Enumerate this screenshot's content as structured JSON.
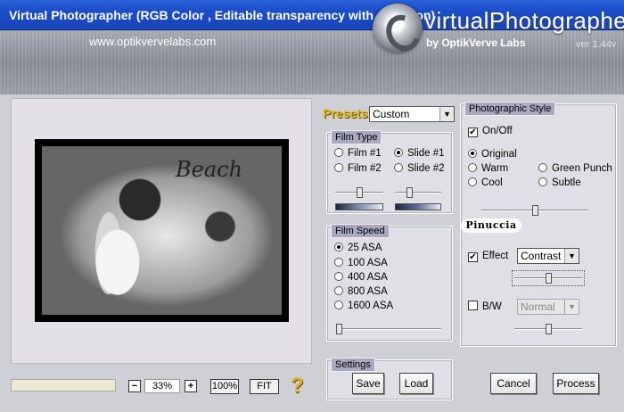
{
  "window": {
    "title": "Virtual Photographer (RGB Color , Editable transparency with selection)"
  },
  "header": {
    "url": "www.optikvervelabs.com",
    "brand": "virtualPhotographer",
    "brand_sub": "by OptikVerve Labs",
    "version": "ver 1.44v"
  },
  "preview": {
    "photo_text": "Beach"
  },
  "zoom": {
    "minus": "−",
    "value": "33%",
    "plus": "+",
    "btn_100": "100%",
    "btn_fit": "FIT",
    "help": "?"
  },
  "presets": {
    "label": "Presets",
    "value": "Custom"
  },
  "film_type": {
    "title": "Film Type",
    "options": [
      "Film #1",
      "Film #2",
      "Slide #1",
      "Slide #2"
    ],
    "selected": "Slide #1",
    "slider_left": 0.5,
    "slider_right": 0.3
  },
  "film_speed": {
    "title": "Film Speed",
    "options": [
      "25 ASA",
      "100 ASA",
      "400 ASA",
      "800 ASA",
      "1600 ASA"
    ],
    "selected": "25 ASA",
    "slider": 0.0
  },
  "settings": {
    "title": "Settings",
    "save": "Save",
    "load": "Load"
  },
  "photo_style": {
    "title": "Photographic Style",
    "onoff_label": "On/Off",
    "onoff_checked": true,
    "styles": [
      "Original",
      "Warm",
      "Cool",
      "Green Punch",
      "Subtle"
    ],
    "selected": "Original",
    "style_slider": 0.5,
    "watermark": "Pinuccia",
    "effect_label": "Effect",
    "effect_checked": true,
    "effect_value": "Contrast",
    "effect_slider": 0.5,
    "bw_label": "B/W",
    "bw_checked": false,
    "bw_value": "Normal",
    "bw_slider": 0.5
  },
  "actions": {
    "cancel": "Cancel",
    "process": "Process"
  },
  "colors": {
    "titlebar": "#1a4cc8",
    "presets_label": "#e0b820",
    "group_title_bg": "#a8a8c0"
  }
}
